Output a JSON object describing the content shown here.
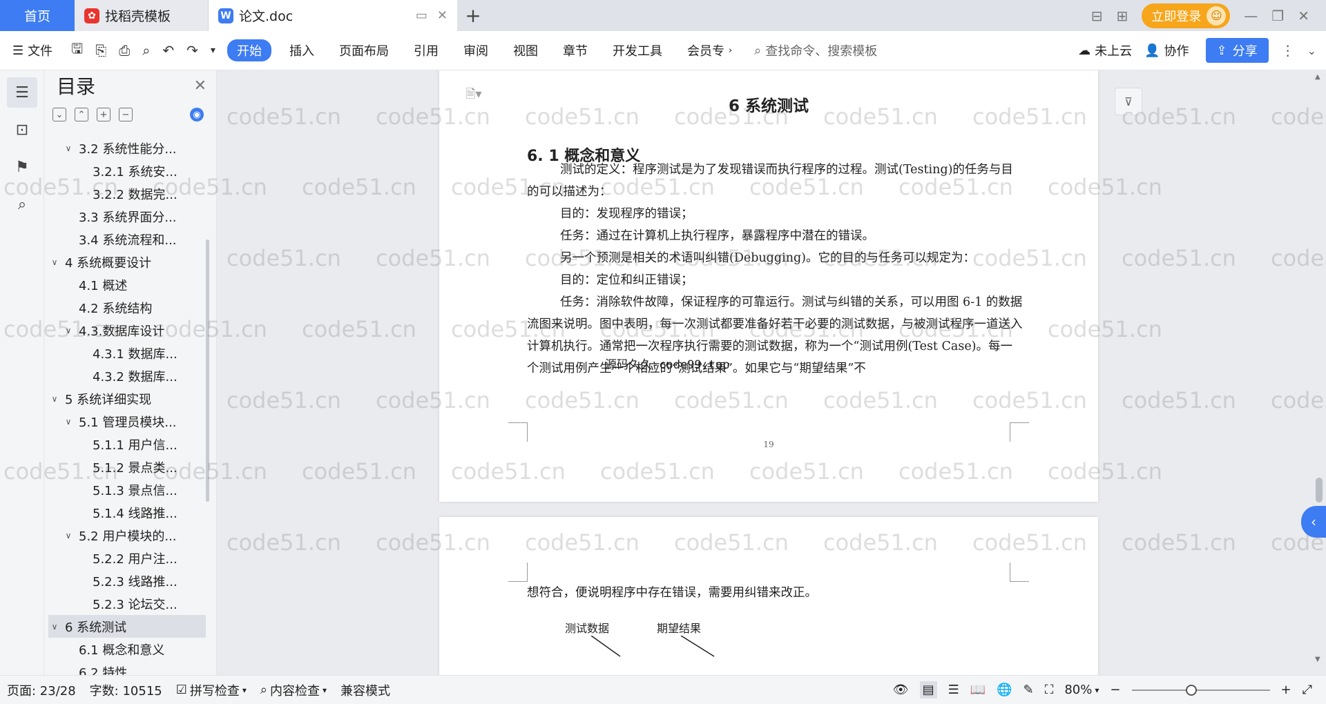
{
  "tabs": {
    "home": "首页",
    "template": "找稻壳模板",
    "doc": "论文.doc"
  },
  "titlebar": {
    "login": "立即登录"
  },
  "toolbar": {
    "file": "文件",
    "start": "开始",
    "insert": "插入",
    "layout": "页面布局",
    "reference": "引用",
    "review": "审阅",
    "view": "视图",
    "chapter": "章节",
    "devtools": "开发工具",
    "member": "会员专",
    "search_placeholder": "查找命令、搜索模板",
    "cloud": "未上云",
    "collab": "协作",
    "share": "分享"
  },
  "toc": {
    "title": "目录",
    "items": [
      {
        "level": 2,
        "arrow": "v",
        "text": "3.2 系统性能分..."
      },
      {
        "level": 3,
        "arrow": "",
        "text": "3.2.1 系统安..."
      },
      {
        "level": 3,
        "arrow": "",
        "text": "3.2.2 数据完..."
      },
      {
        "level": 2,
        "arrow": "",
        "text": "3.3 系统界面分..."
      },
      {
        "level": 2,
        "arrow": "",
        "text": "3.4 系统流程和..."
      },
      {
        "level": 1,
        "arrow": "v",
        "text": "4 系统概要设计"
      },
      {
        "level": 2,
        "arrow": "",
        "text": "4.1 概述"
      },
      {
        "level": 2,
        "arrow": "",
        "text": "4.2 系统结构"
      },
      {
        "level": 2,
        "arrow": "v",
        "text": "4.3.数据库设计"
      },
      {
        "level": 3,
        "arrow": "",
        "text": "4.3.1 数据库..."
      },
      {
        "level": 3,
        "arrow": "",
        "text": "4.3.2 数据库..."
      },
      {
        "level": 1,
        "arrow": "v",
        "text": "5 系统详细实现"
      },
      {
        "level": 2,
        "arrow": "v",
        "text": "5.1 管理员模块..."
      },
      {
        "level": 3,
        "arrow": "",
        "text": "5.1.1 用户信..."
      },
      {
        "level": 3,
        "arrow": "",
        "text": "5.1.2 景点类..."
      },
      {
        "level": 3,
        "arrow": "",
        "text": "5.1.3 景点信..."
      },
      {
        "level": 3,
        "arrow": "",
        "text": "5.1.4 线路推..."
      },
      {
        "level": 2,
        "arrow": "v",
        "text": "5.2 用户模块的..."
      },
      {
        "level": 3,
        "arrow": "",
        "text": "5.2.2 用户注..."
      },
      {
        "level": 3,
        "arrow": "",
        "text": "5.2.3 线路推..."
      },
      {
        "level": 3,
        "arrow": "",
        "text": "5.2.3 论坛交..."
      },
      {
        "level": 1,
        "arrow": "v",
        "text": "6 系统测试",
        "active": true
      },
      {
        "level": 2,
        "arrow": "",
        "text": "6.1 概念和意义"
      },
      {
        "level": 2,
        "arrow": "",
        "text": "6.2 特性"
      }
    ]
  },
  "document": {
    "chapter_title": "6 系统测试",
    "section_title": "6. 1 概念和意义",
    "paragraphs": [
      {
        "indent": true,
        "text": "测试的定义：程序测试是为了发现错误而执行程序的过程。测试(Testing)的任务与目的可以描述为："
      },
      {
        "indent": true,
        "text": "目的：发现程序的错误；"
      },
      {
        "indent": true,
        "text": "任务：通过在计算机上执行程序，暴露程序中潜在的错误。"
      },
      {
        "indent": true,
        "text": "另一个预测是相关的术语叫纠错(Debugging)。它的目的与任务可以规定为："
      },
      {
        "indent": true,
        "text": "目的：定位和纠正错误；"
      },
      {
        "indent": true,
        "text": "任务：消除软件故障，保证程序的可靠运行。测试与纠错的关系，可以用图 6-1 的数据流图来说明。图中表明，每一次测试都要准备好若干必要的测试数据，与被测试程序一道送入计算机执行。通常把一次程序执行需要的测试数据，称为一个“测试用例(Test Case)。每一个测试用例产生一个相应的“测试结果”。如果它与“期望结果”不"
      }
    ],
    "overlay": "源码久久-code99.top",
    "page_number": "19",
    "page2_text": "想符合，便说明程序中存在错误，需要用纠错来改正。",
    "diagram_labels": {
      "left": "测试数据",
      "right": "期望结果"
    }
  },
  "watermark": "code51.cn",
  "statusbar": {
    "page": "页面: 23/28",
    "words": "字数: 10515",
    "spell": "拼写检查",
    "content_check": "内容检查",
    "compat": "兼容模式",
    "zoom": "80%"
  },
  "colors": {
    "accent": "#3d7cf2",
    "login": "#f7a51a"
  }
}
